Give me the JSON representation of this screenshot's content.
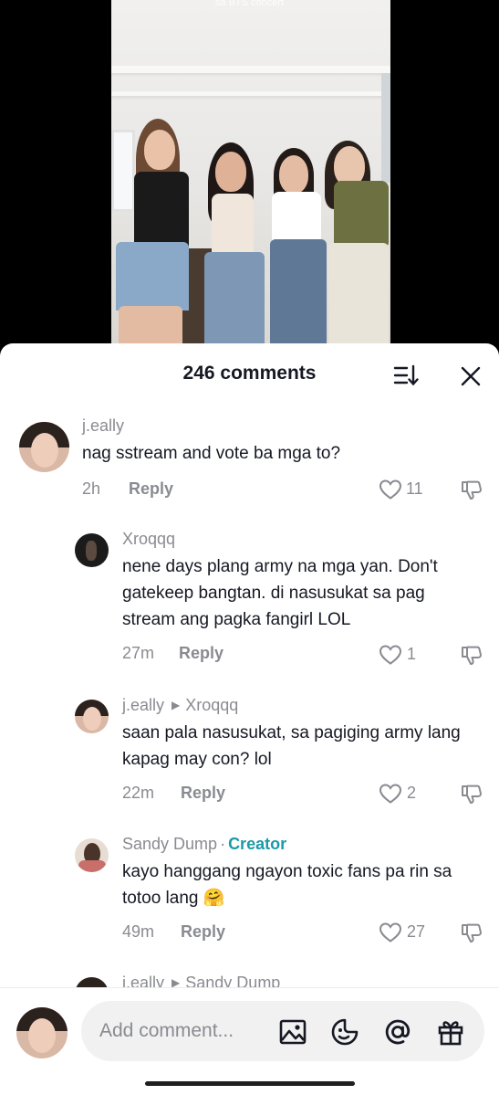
{
  "video": {
    "caption": "sa BTS concert"
  },
  "sheet": {
    "title": "246 comments",
    "sort_icon": "sort-icon",
    "close_icon": "close-icon"
  },
  "comments": [
    {
      "username": "j.eally",
      "text": "nag sstream and vote ba mga to?",
      "time": "2h",
      "reply_label": "Reply",
      "likes": "11"
    },
    {
      "username": "Xroqqq",
      "text": "nene days plang army na mga yan. Don't gatekeep bangtan. di nasusukat sa pag stream ang pagka fangirl LOL",
      "time": "27m",
      "reply_label": "Reply",
      "likes": "1"
    },
    {
      "username": "j.eally",
      "reply_to": "Xroqqq",
      "text": "saan pala nasusukat, sa pagiging army lang kapag may con? lol",
      "time": "22m",
      "reply_label": "Reply",
      "likes": "2"
    },
    {
      "username": "Sandy Dump",
      "badge_separator": "·",
      "badge": "Creator",
      "text": "kayo hanggang ngayon toxic fans pa rin sa totoo lang 🤗",
      "time": "49m",
      "reply_label": "Reply",
      "likes": "27"
    },
    {
      "username": "j.eally",
      "reply_to": "Sandy Dump"
    }
  ],
  "composer": {
    "placeholder": "Add comment...",
    "icons": [
      "image-icon",
      "emoji-icon",
      "mention-icon",
      "gift-icon"
    ]
  },
  "colors": {
    "text": "#161823",
    "muted": "#8a8b91",
    "creator": "#1b9aa8",
    "input_bg": "#f1f1f2"
  }
}
